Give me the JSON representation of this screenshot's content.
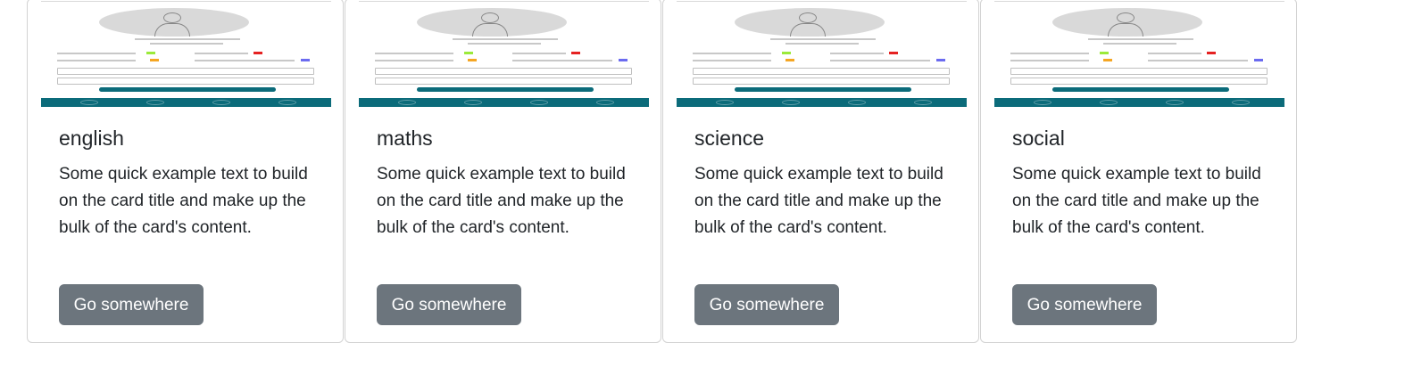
{
  "cards": [
    {
      "title": "english",
      "text": "Some quick example text to build on the card title and make up the bulk of the card's content.",
      "button": "Go somewhere"
    },
    {
      "title": "maths",
      "text": "Some quick example text to build on the card title and make up the bulk of the card's content.",
      "button": "Go somewhere"
    },
    {
      "title": "science",
      "text": "Some quick example text to build on the card title and make up the bulk of the card's content.",
      "button": "Go somewhere"
    },
    {
      "title": "social",
      "text": "Some quick example text to build on the card title and make up the bulk of the card's content.",
      "button": "Go somewhere"
    }
  ],
  "colors": {
    "button_bg": "#6c757d",
    "thumbnail_bar": "#0b6b7a",
    "legend_green": "#9bea3a",
    "legend_red": "#e52222",
    "legend_orange": "#f5a623",
    "legend_blue": "#6b6bf0"
  }
}
